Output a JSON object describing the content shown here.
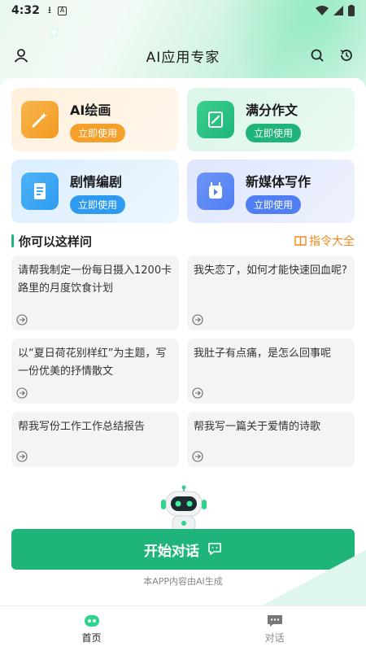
{
  "status_bar": {
    "time": "4:32"
  },
  "header": {
    "title": "AI应用专家"
  },
  "feature_cards": [
    {
      "label": "AI绘画",
      "button": "立即使用",
      "icon": "paint-wand-icon",
      "accent": "#f4a02a"
    },
    {
      "label": "满分作文",
      "button": "立即使用",
      "icon": "pen-document-icon",
      "accent": "#1fb57a"
    },
    {
      "label": "剧情编剧",
      "button": "立即使用",
      "icon": "script-document-icon",
      "accent": "#2e9bf0"
    },
    {
      "label": "新媒体写作",
      "button": "立即使用",
      "icon": "media-play-icon",
      "accent": "#4f7ff2"
    }
  ],
  "section": {
    "title": "你可以这样问",
    "more_label": "指令大全"
  },
  "questions": [
    "请帮我制定一份每日摄入1200卡路里的月度饮食计划",
    "我失恋了，如何才能快速回血呢?",
    "以“夏日荷花别样红”为主题，写一份优美的抒情散文",
    "我肚子有点痛，是怎么回事呢",
    "帮我写份工作工作总结报告",
    "帮我写一篇关于爱情的诗歌"
  ],
  "cta": {
    "label": "开始对话"
  },
  "disclaimer": "本APP内容由AI生成",
  "nav": [
    {
      "label": "首页",
      "active": true
    },
    {
      "label": "对话",
      "active": false
    }
  ],
  "colors": {
    "primary": "#1fb57a",
    "orange": "#f08a1c"
  }
}
